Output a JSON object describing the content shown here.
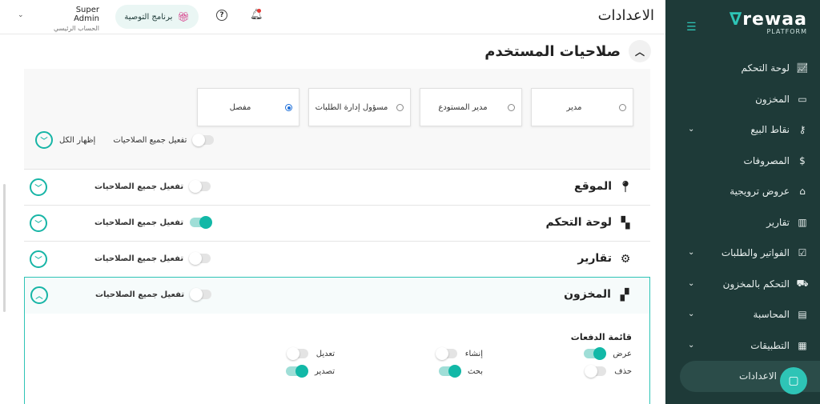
{
  "sidebar": {
    "brand": "rewaa",
    "brand_sub": "PLATFORM",
    "items": [
      {
        "label": "لوحة التحكم",
        "icon": "chart-line-icon",
        "chevron": false
      },
      {
        "label": "المخزون",
        "icon": "inbox-icon",
        "chevron": false
      },
      {
        "label": "نقاط البيع",
        "icon": "key-icon",
        "chevron": true
      },
      {
        "label": "المصروفات",
        "icon": "dollar-circle-icon",
        "chevron": false
      },
      {
        "label": "عروض ترويجية",
        "icon": "tag-icon",
        "chevron": false
      },
      {
        "label": "تقارير",
        "icon": "bar-chart-icon",
        "chevron": false
      },
      {
        "label": "الفواتير والطلبات",
        "icon": "checkbox-icon",
        "chevron": true
      },
      {
        "label": "التحكم بالمخزون",
        "icon": "cart-icon",
        "chevron": true
      },
      {
        "label": "المحاسبة",
        "icon": "book-icon",
        "chevron": true
      },
      {
        "label": "التطبيقات",
        "icon": "apps-grid-icon",
        "chevron": true
      },
      {
        "label": "الاعدادات",
        "icon": "",
        "chevron": false,
        "active": true
      }
    ]
  },
  "topbar": {
    "title": "الاعدادات",
    "user_name": "Super Admin",
    "user_role": "الحساب الرئيسي",
    "referral_label": "برنامج التوصية"
  },
  "section": {
    "title": "صلاحيات المستخدم",
    "roles": [
      {
        "label": "مدير",
        "selected": false
      },
      {
        "label": "مدير المستودع",
        "selected": false
      },
      {
        "label": "مسؤول إدارة الطلبات",
        "selected": false
      },
      {
        "label": "مفصل",
        "selected": true
      }
    ],
    "enable_all_label": "تفعيل جميع الصلاحيات",
    "show_all_label": "إظهار الكل"
  },
  "modules": [
    {
      "name": "الموقع",
      "icon": "location-pin-icon",
      "toggle_label": "تفعيل جميع الصلاحيات",
      "enabled": false
    },
    {
      "name": "لوحة التحكم",
      "icon": "dashboard-grid-icon",
      "toggle_label": "تفعيل جميع الصلاحيات",
      "enabled": true
    },
    {
      "name": "تقارير",
      "icon": "gear-icon",
      "toggle_label": "تفعيل جميع الصلاحيات",
      "enabled": false
    },
    {
      "name": "المخزون",
      "icon": "boxes-icon",
      "toggle_label": "تفعيل جميع الصلاحيات",
      "enabled": false
    }
  ],
  "inventory": {
    "subsection_title": "قائمة الدفعات",
    "permissions": [
      {
        "label": "عرض",
        "enabled": true
      },
      {
        "label": "إنشاء",
        "enabled": false
      },
      {
        "label": "تعديل",
        "enabled": false
      },
      {
        "label": "حذف",
        "enabled": false
      },
      {
        "label": "بحث",
        "enabled": true
      },
      {
        "label": "تصدير",
        "enabled": true
      }
    ]
  }
}
